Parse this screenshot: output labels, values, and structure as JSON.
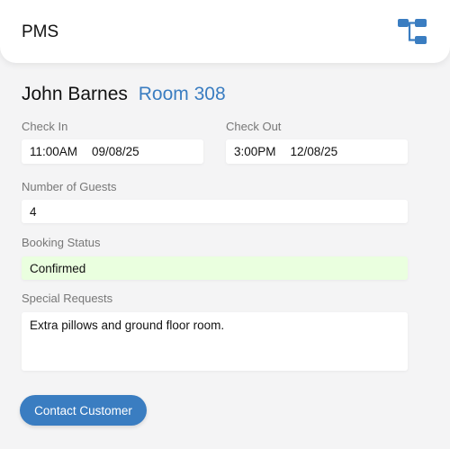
{
  "app": {
    "title": "PMS",
    "icon": "hierarchy-icon",
    "accent": "#3a7dc1"
  },
  "guest": {
    "name": "John Barnes",
    "room": "Room 308"
  },
  "check_in": {
    "label": "Check In",
    "time": "11:00AM",
    "date": "09/08/25"
  },
  "check_out": {
    "label": "Check Out",
    "time": "3:00PM",
    "date": "12/08/25"
  },
  "guests": {
    "label": "Number of Guests",
    "value": "4"
  },
  "booking_status": {
    "label": "Booking Status",
    "value": "Confirmed",
    "color": "#eaffdf"
  },
  "special_requests": {
    "label": "Special Requests",
    "value": "Extra pillows and ground floor room."
  },
  "actions": {
    "contact_label": "Contact Customer"
  }
}
